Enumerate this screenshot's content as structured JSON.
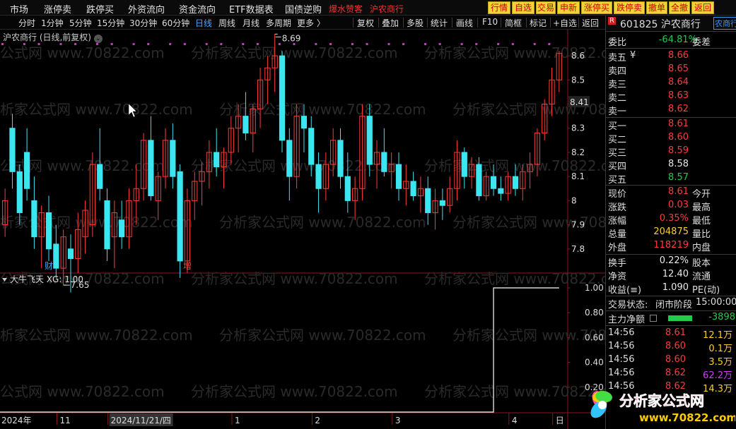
{
  "menu": {
    "items": [
      "市场",
      "涨停卖",
      "跌停买",
      "外资流向",
      "资金流向",
      "ETF数据表",
      "国债逆购"
    ],
    "tag1": "爆水赞客",
    "tag2": "沪农商行"
  },
  "quickbtns": [
    "行情",
    "自选",
    "交易",
    "申新",
    "涨停买",
    "跌停卖",
    "撤单",
    "全撤",
    "返回"
  ],
  "toolbar": {
    "periods": [
      "分时",
      "1分钟",
      "5分钟",
      "15分钟",
      "30分钟",
      "60分钟",
      "日线",
      "周线",
      "月线",
      "多周期",
      "更多 〉"
    ],
    "active": "日线",
    "tools": [
      "复权",
      "叠加",
      "多股",
      "统计",
      "画线",
      "F10",
      "简框",
      "标记",
      "+自选",
      "返回"
    ]
  },
  "chart_title": "沪农商行 (日线,前复权)",
  "indicator_title": "大牛飞天 XG: 1.00",
  "watermark": "分析家公式网 www.70822.com",
  "chart_data": {
    "type": "candlestick",
    "stock": "沪农商行",
    "ohlc": [
      [
        7.9,
        8.05,
        7.85,
        8.0
      ],
      [
        8.3,
        8.36,
        8.05,
        8.12
      ],
      [
        8.12,
        8.15,
        7.9,
        7.95
      ],
      [
        8.2,
        8.3,
        8.0,
        8.05
      ],
      [
        8.0,
        8.1,
        7.8,
        7.85
      ],
      [
        7.85,
        7.98,
        7.72,
        7.95
      ],
      [
        7.95,
        8.02,
        7.75,
        7.8
      ],
      [
        7.82,
        7.9,
        7.68,
        7.72
      ],
      [
        7.72,
        7.88,
        7.65,
        7.85
      ],
      [
        7.8,
        7.86,
        7.62,
        7.76
      ],
      [
        7.76,
        7.95,
        7.7,
        7.88
      ],
      [
        7.85,
        8.0,
        7.78,
        7.96
      ],
      [
        7.9,
        8.2,
        7.85,
        8.15
      ],
      [
        8.15,
        8.3,
        8.0,
        8.05
      ],
      [
        8.0,
        8.05,
        7.75,
        7.8
      ],
      [
        7.85,
        8.0,
        7.72,
        7.95
      ],
      [
        7.92,
        8.0,
        7.8,
        7.85
      ],
      [
        7.85,
        8.05,
        7.8,
        8.0
      ],
      [
        8.0,
        8.15,
        7.9,
        8.05
      ],
      [
        8.05,
        8.28,
        8.0,
        8.25
      ],
      [
        8.25,
        8.35,
        8.0,
        8.02
      ],
      [
        8.0,
        8.12,
        7.92,
        8.1
      ],
      [
        8.1,
        8.3,
        8.05,
        8.25
      ],
      [
        8.25,
        8.32,
        8.05,
        8.1
      ],
      [
        8.12,
        8.15,
        7.68,
        7.75
      ],
      [
        7.75,
        8.05,
        7.7,
        8.0
      ],
      [
        8.0,
        8.12,
        7.92,
        8.08
      ],
      [
        8.08,
        8.16,
        7.98,
        8.12
      ],
      [
        8.12,
        8.25,
        8.05,
        8.2
      ],
      [
        8.2,
        8.3,
        8.1,
        8.14
      ],
      [
        8.14,
        8.22,
        8.05,
        8.2
      ],
      [
        8.2,
        8.35,
        8.15,
        8.3
      ],
      [
        8.3,
        8.4,
        8.2,
        8.35
      ],
      [
        8.35,
        8.45,
        8.25,
        8.28
      ],
      [
        8.28,
        8.4,
        8.2,
        8.38
      ],
      [
        8.38,
        8.55,
        8.3,
        8.5
      ],
      [
        8.5,
        8.6,
        8.4,
        8.55
      ],
      [
        8.55,
        8.69,
        8.45,
        8.6
      ],
      [
        8.6,
        8.62,
        8.2,
        8.25
      ],
      [
        8.25,
        8.3,
        8.0,
        8.1
      ],
      [
        8.1,
        8.4,
        8.05,
        8.35
      ],
      [
        8.35,
        8.4,
        8.2,
        8.3
      ],
      [
        8.3,
        8.35,
        8.1,
        8.15
      ],
      [
        8.15,
        8.2,
        7.95,
        8.05
      ],
      [
        8.05,
        8.2,
        8.0,
        8.15
      ],
      [
        8.15,
        8.3,
        8.1,
        8.25
      ],
      [
        8.25,
        8.3,
        8.05,
        8.1
      ],
      [
        8.1,
        8.2,
        7.95,
        8.0
      ],
      [
        8.0,
        8.1,
        7.92,
        8.05
      ],
      [
        8.05,
        8.4,
        8.0,
        8.35
      ],
      [
        8.35,
        8.4,
        8.1,
        8.15
      ],
      [
        8.15,
        8.25,
        8.05,
        8.2
      ],
      [
        8.2,
        8.3,
        8.1,
        8.12
      ],
      [
        8.12,
        8.2,
        8.05,
        8.15
      ],
      [
        8.15,
        8.2,
        8.0,
        8.05
      ],
      [
        8.05,
        8.15,
        7.98,
        8.08
      ],
      [
        8.08,
        8.12,
        8.0,
        8.02
      ],
      [
        8.02,
        8.1,
        7.95,
        8.05
      ],
      [
        8.05,
        8.1,
        7.9,
        7.95
      ],
      [
        7.95,
        8.05,
        7.88,
        8.0
      ],
      [
        8.0,
        8.05,
        7.92,
        7.98
      ],
      [
        7.98,
        8.1,
        7.95,
        8.05
      ],
      [
        8.05,
        8.25,
        8.0,
        8.2
      ],
      [
        8.2,
        8.22,
        8.05,
        8.1
      ],
      [
        8.1,
        8.18,
        8.05,
        8.15
      ],
      [
        8.15,
        8.18,
        8.0,
        8.02
      ],
      [
        8.02,
        8.12,
        8.0,
        8.1
      ],
      [
        8.1,
        8.15,
        8.02,
        8.05
      ],
      [
        8.05,
        8.1,
        8.0,
        8.03
      ],
      [
        8.03,
        8.12,
        8.0,
        8.1
      ],
      [
        8.1,
        8.15,
        8.02,
        8.05
      ],
      [
        8.05,
        8.15,
        8.0,
        8.12
      ],
      [
        8.12,
        8.2,
        8.05,
        8.15
      ],
      [
        8.15,
        8.3,
        8.1,
        8.28
      ],
      [
        8.28,
        8.42,
        8.25,
        8.4
      ],
      [
        8.4,
        8.55,
        8.35,
        8.5
      ],
      [
        8.5,
        8.62,
        8.45,
        8.61
      ]
    ],
    "ylim": [
      7.7,
      8.65
    ],
    "yticks": [
      8.6,
      8.5,
      8.4,
      8.3,
      8.2,
      8.1,
      8.0,
      7.9,
      7.8
    ],
    "annotations": [
      {
        "text": "8.69",
        "price": 8.69,
        "bar": 37
      },
      {
        "text": "7.65",
        "price": 7.65,
        "bar": 8
      },
      {
        "text": "财",
        "bar": 6
      },
      {
        "text": "增",
        "bar": 25
      }
    ],
    "current_price_label": "8.41",
    "indicator": {
      "name": "大牛飞天",
      "xg": [
        0,
        0,
        0,
        0,
        0,
        0,
        0,
        0,
        0,
        0,
        0,
        0,
        0,
        0,
        0,
        0,
        0,
        0,
        0,
        0,
        0,
        0,
        0,
        0,
        0,
        0,
        0,
        0,
        0,
        0,
        0,
        0,
        0,
        0,
        0,
        0,
        0,
        0,
        0,
        0,
        0,
        0,
        0,
        0,
        0,
        0,
        0,
        0,
        0,
        0,
        0,
        0,
        0,
        0,
        0,
        0,
        0,
        0,
        0,
        0,
        0,
        0,
        0,
        0,
        0,
        0,
        0,
        1,
        1,
        1,
        1,
        1,
        1,
        1,
        1,
        1,
        1
      ],
      "yticks": [
        1.0,
        0.8,
        0.6,
        0.4,
        0.2
      ],
      "ylim": [
        0,
        1
      ]
    },
    "xlabels": [
      {
        "text": "2024年",
        "bar": 0
      },
      {
        "text": "11",
        "bar": 8
      },
      {
        "text": "2024/11/21/四",
        "bar": 15
      },
      {
        "text": "1",
        "bar": 32
      },
      {
        "text": "2",
        "bar": 43
      },
      {
        "text": "3",
        "bar": 54
      },
      {
        "text": "4",
        "bar": 70
      },
      {
        "text": "日",
        "bar": 76
      }
    ]
  },
  "panel": {
    "code_line": "601825 沪农商行",
    "badge": "R",
    "tab": "农商行",
    "weibi_label": "委比",
    "weibi_value": "-64.81%",
    "weicha_label": "委差",
    "asks": [
      {
        "label": "卖五",
        "sub": "¥",
        "price": "8.66"
      },
      {
        "label": "卖四",
        "sub": "",
        "price": "8.65"
      },
      {
        "label": "卖三",
        "sub": "",
        "price": "8.64"
      },
      {
        "label": "卖二",
        "sub": "",
        "price": "8.63"
      },
      {
        "label": "卖一",
        "sub": "",
        "price": "8.62"
      }
    ],
    "bids": [
      {
        "label": "买一",
        "price": "8.61",
        "color": "red"
      },
      {
        "label": "买二",
        "price": "8.60",
        "color": "red"
      },
      {
        "label": "买三",
        "price": "8.59",
        "color": "red"
      },
      {
        "label": "买四",
        "price": "8.58",
        "color": "wht"
      },
      {
        "label": "买五",
        "price": "8.57",
        "color": "green"
      }
    ],
    "stats1": [
      {
        "l": "现价",
        "v": "8.61",
        "c": "red",
        "r": "今开"
      },
      {
        "l": "涨跌",
        "v": "0.03",
        "c": "red",
        "r": "最高"
      },
      {
        "l": "涨幅",
        "v": "0.35%",
        "c": "red",
        "r": "最低"
      },
      {
        "l": "总量",
        "v": "204875",
        "c": "yel",
        "r": "量比"
      },
      {
        "l": "外盘",
        "v": "118219",
        "c": "red",
        "r": "内盘"
      }
    ],
    "stats2": [
      {
        "l": "换手",
        "v": "0.22%",
        "c": "wht",
        "r": "股本"
      },
      {
        "l": "净资",
        "v": "12.40",
        "c": "wht",
        "r": "流通"
      },
      {
        "l": "收益(≡)",
        "v": "1.090",
        "c": "wht",
        "r": "PE(动)"
      }
    ],
    "trade_status_label": "交易状态:",
    "trade_status": "闭市阶段",
    "trade_time": "15:00:00",
    "mainflow_label": "主力净额",
    "mainflow_value": "-3898",
    "ticks": [
      {
        "t": "14:56",
        "p": "8.61",
        "pc": "red",
        "v": "12.1万",
        "vc": "yel"
      },
      {
        "t": "14:56",
        "p": "8.60",
        "pc": "red",
        "v": "0.1万",
        "vc": "yel"
      },
      {
        "t": "14:56",
        "p": "8.60",
        "pc": "red",
        "v": "3.5万",
        "vc": "yel"
      },
      {
        "t": "14:56",
        "p": "8.62",
        "pc": "red",
        "v": "62.2万",
        "vc": "mag"
      },
      {
        "t": "14:56",
        "p": "8.62",
        "pc": "red",
        "v": "14.3万",
        "vc": "yel"
      }
    ]
  },
  "logo": {
    "text": "分析家公式网",
    "url": "www.70822.com"
  }
}
